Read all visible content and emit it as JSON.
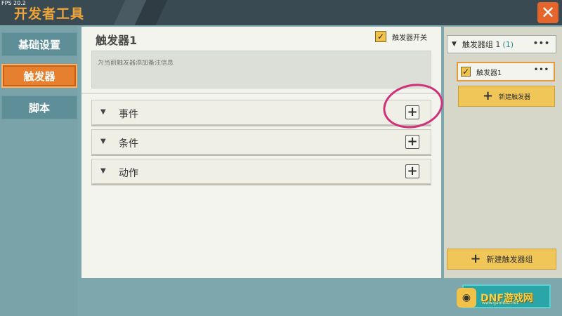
{
  "titlebar": {
    "fps": "FPS 20.2",
    "title": "开发者工具",
    "close_icon": "✕"
  },
  "sidebar": {
    "items": [
      {
        "label": "基础设置",
        "active": false
      },
      {
        "label": "触发器",
        "active": true
      },
      {
        "label": "脚本",
        "active": false
      }
    ]
  },
  "main": {
    "trigger_name": "触发器1",
    "switch_label": "触发器开关",
    "switch_checked": true,
    "note_placeholder": "为当前触发器添加备注信息",
    "sections": [
      {
        "label": "事件"
      },
      {
        "label": "条件"
      },
      {
        "label": "动作"
      }
    ]
  },
  "right_panel": {
    "group_name": "触发器组 1",
    "group_count": "(1)",
    "menu_dots": "•••",
    "trigger_item": "触发器1",
    "new_trigger": "新建触发器",
    "new_group": "新建触发器组"
  },
  "watermark": {
    "text": "DNF游戏网",
    "sub": "www.gamedz.net"
  },
  "colors": {
    "accent": "#e67f2e",
    "annotation": "#d0307a"
  }
}
